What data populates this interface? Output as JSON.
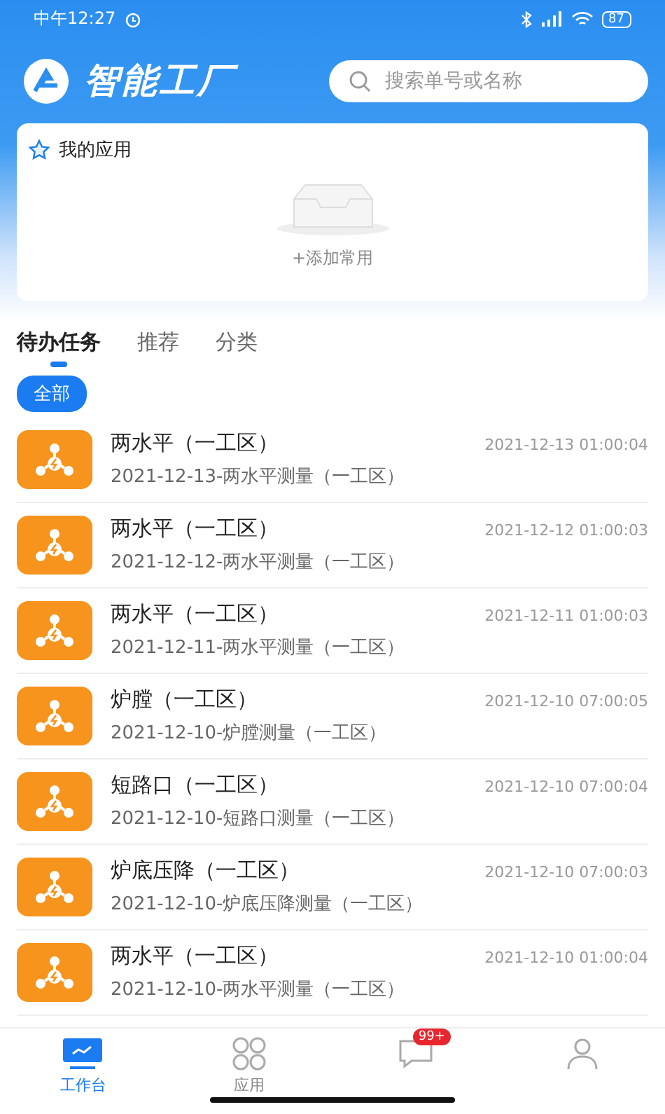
{
  "status_bar": {
    "time": "中午12:27",
    "battery": "87"
  },
  "header": {
    "app_name": "智能工厂",
    "search": {
      "placeholder": "搜索单号或名称"
    }
  },
  "my_apps": {
    "title": "我的应用",
    "empty_action": "+添加常用"
  },
  "tabs": [
    {
      "label": "待办任务",
      "selected": true
    },
    {
      "label": "推荐",
      "selected": false
    },
    {
      "label": "分类",
      "selected": false
    }
  ],
  "filters": [
    {
      "label": "全部",
      "selected": true
    }
  ],
  "tasks": [
    {
      "title": "两水平（一工区）",
      "time": "2021-12-13 01:00:04",
      "subtitle": "2021-12-13-两水平测量（一工区）"
    },
    {
      "title": "两水平（一工区）",
      "time": "2021-12-12 01:00:03",
      "subtitle": "2021-12-12-两水平测量（一工区）"
    },
    {
      "title": "两水平（一工区）",
      "time": "2021-12-11 01:00:03",
      "subtitle": "2021-12-11-两水平测量（一工区）"
    },
    {
      "title": "炉膛（一工区）",
      "time": "2021-12-10 07:00:05",
      "subtitle": "2021-12-10-炉膛测量（一工区）"
    },
    {
      "title": "短路口（一工区）",
      "time": "2021-12-10 07:00:04",
      "subtitle": "2021-12-10-短路口测量（一工区）"
    },
    {
      "title": "炉底压降（一工区）",
      "time": "2021-12-10 07:00:03",
      "subtitle": "2021-12-10-炉底压降测量（一工区）"
    },
    {
      "title": "两水平（一工区）",
      "time": "2021-12-10 01:00:04",
      "subtitle": "2021-12-10-两水平测量（一工区）"
    }
  ],
  "bottom_nav": [
    {
      "kind": "workbench",
      "label": "工作台",
      "selected": true
    },
    {
      "kind": "apps",
      "label": "应用",
      "selected": false
    },
    {
      "kind": "messages",
      "badge": "99+",
      "selected": false
    },
    {
      "kind": "profile",
      "selected": false
    }
  ]
}
